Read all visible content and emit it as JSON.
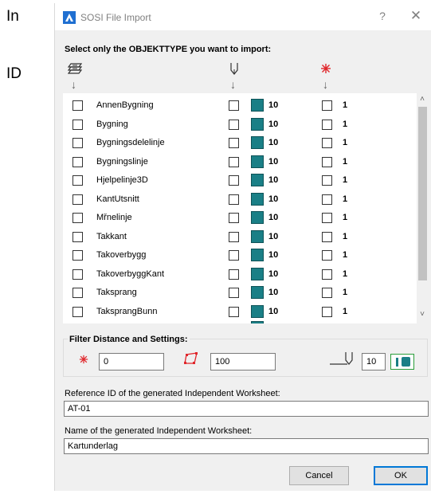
{
  "side_labels": {
    "top": "In",
    "bottom": "ID"
  },
  "window": {
    "title": "SOSI File Import",
    "help": "?",
    "close": "✕"
  },
  "instruction": "Select only the OBJEKTTYPE you want to import:",
  "columns": {
    "arrow": "↓",
    "icons": [
      "objects-stack-icon",
      "pen-icon",
      "layer-icon"
    ]
  },
  "object_types": [
    {
      "name": "AnnenBygning",
      "pen": "10",
      "layer": "1"
    },
    {
      "name": "Bygning",
      "pen": "10",
      "layer": "1"
    },
    {
      "name": "Bygningsdelelinje",
      "pen": "10",
      "layer": "1"
    },
    {
      "name": "Bygningslinje",
      "pen": "10",
      "layer": "1"
    },
    {
      "name": "Hjelpelinje3D",
      "pen": "10",
      "layer": "1"
    },
    {
      "name": "KantUtsnitt",
      "pen": "10",
      "layer": "1"
    },
    {
      "name": "Mřnelinje",
      "pen": "10",
      "layer": "1"
    },
    {
      "name": "Takkant",
      "pen": "10",
      "layer": "1"
    },
    {
      "name": "Takoverbygg",
      "pen": "10",
      "layer": "1"
    },
    {
      "name": "TakoverbyggKant",
      "pen": "10",
      "layer": "1"
    },
    {
      "name": "Taksprang",
      "pen": "10",
      "layer": "1"
    },
    {
      "name": "TaksprangBunn",
      "pen": "10",
      "layer": "1"
    }
  ],
  "filter": {
    "label": "Filter Distance and Settings:",
    "layer_value": "0",
    "distance_value": "100",
    "pen_value": "10"
  },
  "reference": {
    "label": "Reference ID of the generated Independent Worksheet:",
    "value": "AT-01"
  },
  "worksheet_name": {
    "label": "Name of the generated Independent Worksheet:",
    "value": "Kartunderlag"
  },
  "buttons": {
    "cancel": "Cancel",
    "ok": "OK"
  },
  "colors": {
    "swatch": "#1a7f86",
    "accent": "#0078d7",
    "star": "#e0262b"
  }
}
